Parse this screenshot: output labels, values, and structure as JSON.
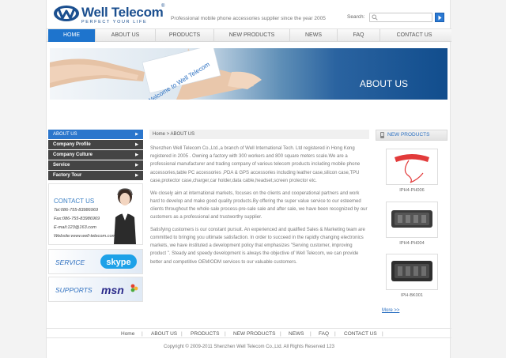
{
  "header": {
    "brand": "Well Telecom",
    "reg_mark": "®",
    "tagline": "PERFECT YOUR LIFE",
    "slogan": "Professional mobile phone accessories supplier since the year 2005",
    "search_label": "Search:",
    "search_placeholder": ""
  },
  "nav": {
    "items": [
      "HOME",
      "ABOUT US",
      "PRODUCTS",
      "NEW PRODUCTS",
      "NEWS",
      "FAQ",
      "CONTACT US"
    ],
    "active": "HOME"
  },
  "banner": {
    "title": "ABOUT US",
    "card_text": "Welcome to Well Telecom"
  },
  "sidebar": {
    "menu": [
      {
        "label": "ABOUT US",
        "arrow": "▶"
      },
      {
        "label": "Company Profile",
        "arrow": "▶"
      },
      {
        "label": "Company Culture",
        "arrow": "▶"
      },
      {
        "label": "Service",
        "arrow": "▶"
      },
      {
        "label": "Factory Tour",
        "arrow": "▶"
      }
    ],
    "contact": {
      "title": "CONTACT US",
      "tel": "Tel:086-755-83986969",
      "fax": "Fax:086-755-83986969",
      "email": "E-mail:123@163.com",
      "website": "Website:www.well-telecom.com"
    },
    "service_label": "SERVICE",
    "supports_label": "SUPPORTS",
    "skype_text": "skype",
    "msn_text": "msn"
  },
  "breadcrumb": "Home > ABOUT US",
  "content": {
    "paragraphs": [
      "Shenzhen Well Telecom Co.,Ltd.,a branch of Well International Tech. Ltd registered in Hong Kong registered in 2005 . Owning a factory with 300 workers and 800 square meters scale.We are a professional manufacturer and trading company of various telecom products including mobile phone accessories,table PC accessories ,PDA & GPS accessories including leather case,silicon case,TPU case,protector case,charger,car holder,data cable,headset,screen protector etc.",
      "We closely aim at international markets, focuses on the clients and cooperational partners and work hard to develop and make good quality products.By offering the super value service to our esteemed clients throughout the whole sale process-pre-sale sale and after sale, we have been recognized by our customers as a professional and trustworthy supplier.",
      "Satisfying customers is our constant pursuit. An experienced and qualified Sales & Marketing team are committed to bringing you ultimate satisfaction. In order to succeed in the rapidly changing electronics markets, we have instituted a development policy that emphasizes \"Serving customer, improving product \". Steady and speedy development is always the objective of Well Telecom, we can provide better and competitive OEM/ODM services to our valuable customers."
    ]
  },
  "new_products": {
    "heading": "NEW PRODUCTS",
    "items": [
      {
        "caption": "IPH4-PH006"
      },
      {
        "caption": "IPH4-PH004"
      },
      {
        "caption": "IPH-BK001"
      }
    ],
    "more": "More >>"
  },
  "footer": {
    "links": [
      "Home",
      "ABOUT US",
      "PRODUCTS",
      "NEW PRODUCTS",
      "NEWS",
      "FAQ",
      "CONTACT US"
    ],
    "separator": "|",
    "copyright": "Copyright © 2009-2011   Shenzhen Well Telecom Co.,Ltd.   All Rights Reserved    123"
  },
  "colors": {
    "accent": "#1e74cd",
    "brand": "#1b4f8f",
    "sidebar_dark": "#444444"
  }
}
